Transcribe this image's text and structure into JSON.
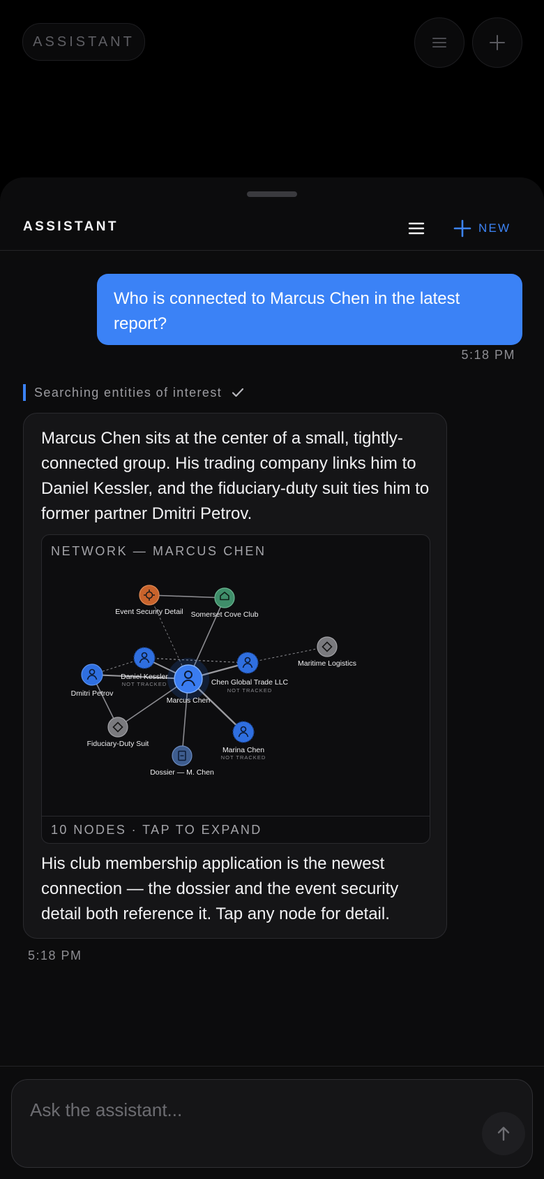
{
  "background": {
    "title": "ASSISTANT",
    "menu_icon": "hamburger-icon",
    "add_icon": "plus-icon"
  },
  "sheet": {
    "title": "ASSISTANT",
    "menu_icon": "hamburger-icon",
    "new_label": "NEW",
    "accent_color": "#3b82f6"
  },
  "conversation": {
    "user_message": "Who is connected to Marcus Chen in the latest report?",
    "user_time": "5:18 PM",
    "status_text": "Searching entities of interest",
    "assistant_intro": "Marcus Chen sits at the center of a small, tightly-connected group. His trading company links him to Daniel Kessler, and the fiduciary-duty suit ties him to former partner Dmitri Petrov.",
    "assistant_outro": "His club membership application is the newest connection — the dossier and the event security detail both reference it. Tap any node for detail.",
    "assistant_time": "5:18 PM"
  },
  "network": {
    "title": "NETWORK — MARCUS CHEN",
    "footer": "10 NODES · TAP TO EXPAND",
    "sub_label": "NOT TRACKED",
    "nodes": {
      "event_security": "Event Security Detail",
      "somerset": "Somerset Cove Club",
      "maritime": "Maritime Logistics",
      "kessler": "Daniel Kessler",
      "chen_global": "Chen Global Trade LLC",
      "petrov": "Dmitri Petrov",
      "marcus": "Marcus Chen",
      "fiduciary": "Fiduciary-Duty Suit",
      "marina": "Marina Chen",
      "dossier": "Dossier — M. Chen"
    },
    "colors": {
      "person": "#2f6fe0",
      "event": "#c8632c",
      "place": "#3f8e6a",
      "org": "#7a7a7e",
      "document": "#3e5d8f"
    }
  },
  "composer": {
    "placeholder": "Ask the assistant...",
    "send_icon": "arrow-up-icon"
  }
}
